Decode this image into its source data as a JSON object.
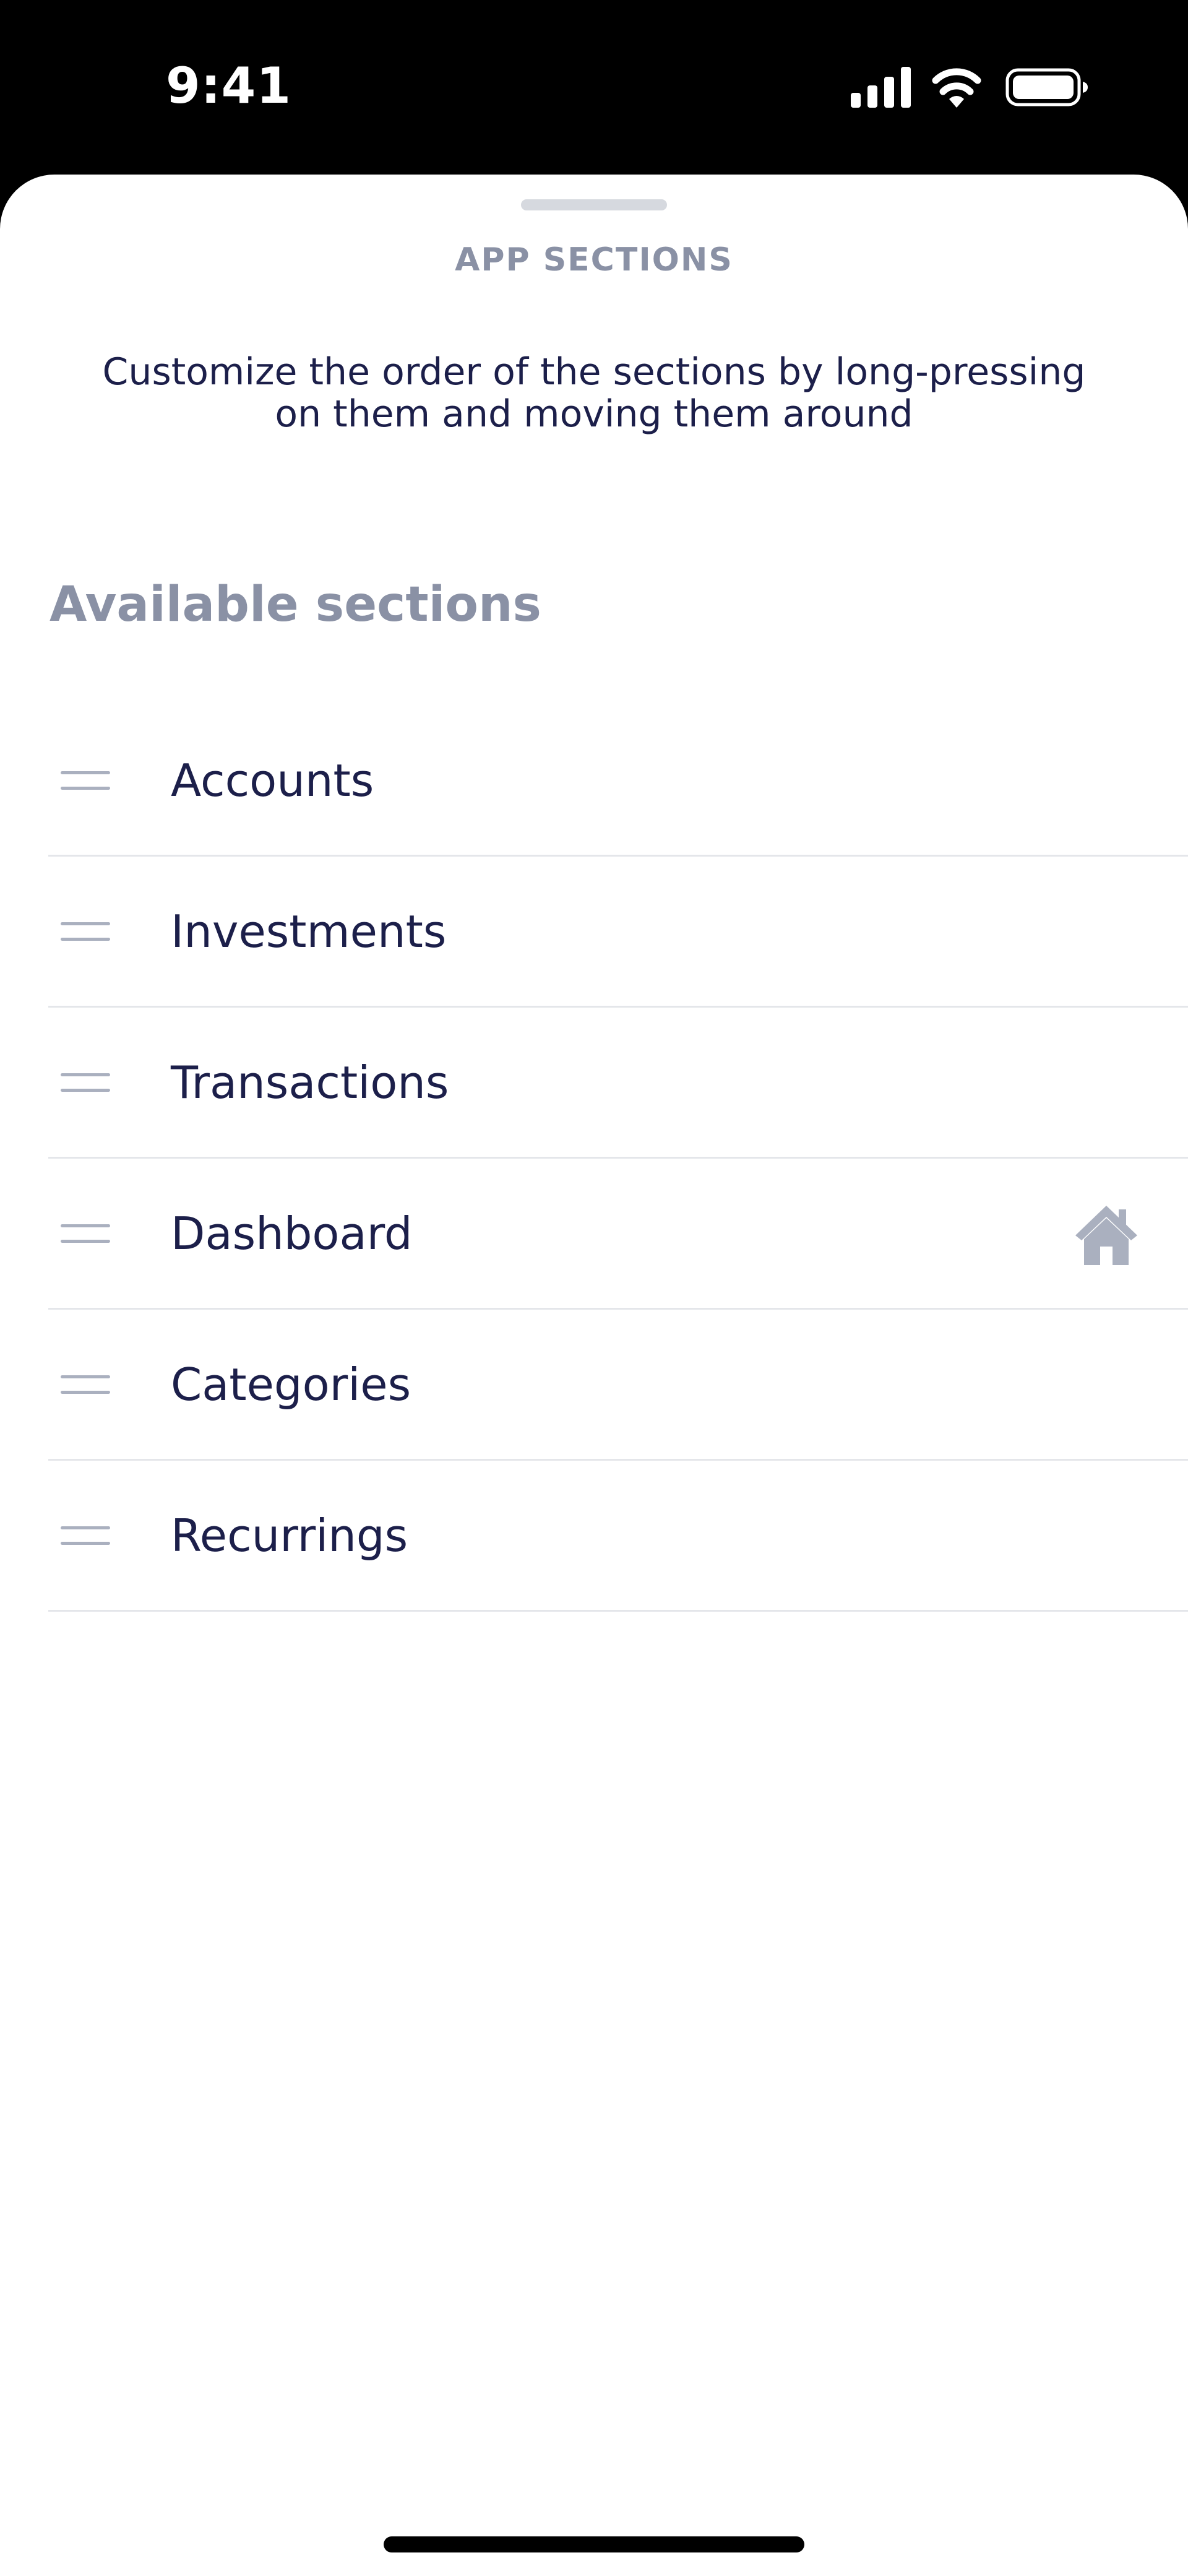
{
  "status_bar": {
    "time": "9:41",
    "signal_icon": "cellular-signal-icon",
    "wifi_icon": "wifi-icon",
    "battery_icon": "battery-icon"
  },
  "sheet": {
    "title": "APP SECTIONS",
    "instructions_line1": "Customize the order of the sections by long-pressing",
    "instructions_line2": "on them and moving them around",
    "section_header": "Available sections",
    "items": [
      {
        "label": "Accounts",
        "home": false
      },
      {
        "label": "Investments",
        "home": false
      },
      {
        "label": "Transactions",
        "home": false
      },
      {
        "label": "Dashboard",
        "home": true
      },
      {
        "label": "Categories",
        "home": false
      },
      {
        "label": "Recurrings",
        "home": false
      }
    ],
    "home_icon": "house-icon",
    "drag_icon": "drag-handle-icon"
  },
  "colors": {
    "text_primary": "#1c1f4a",
    "text_secondary": "#8a91a5",
    "divider": "#e4e6ea",
    "icon_gray": "#aab0bf"
  }
}
